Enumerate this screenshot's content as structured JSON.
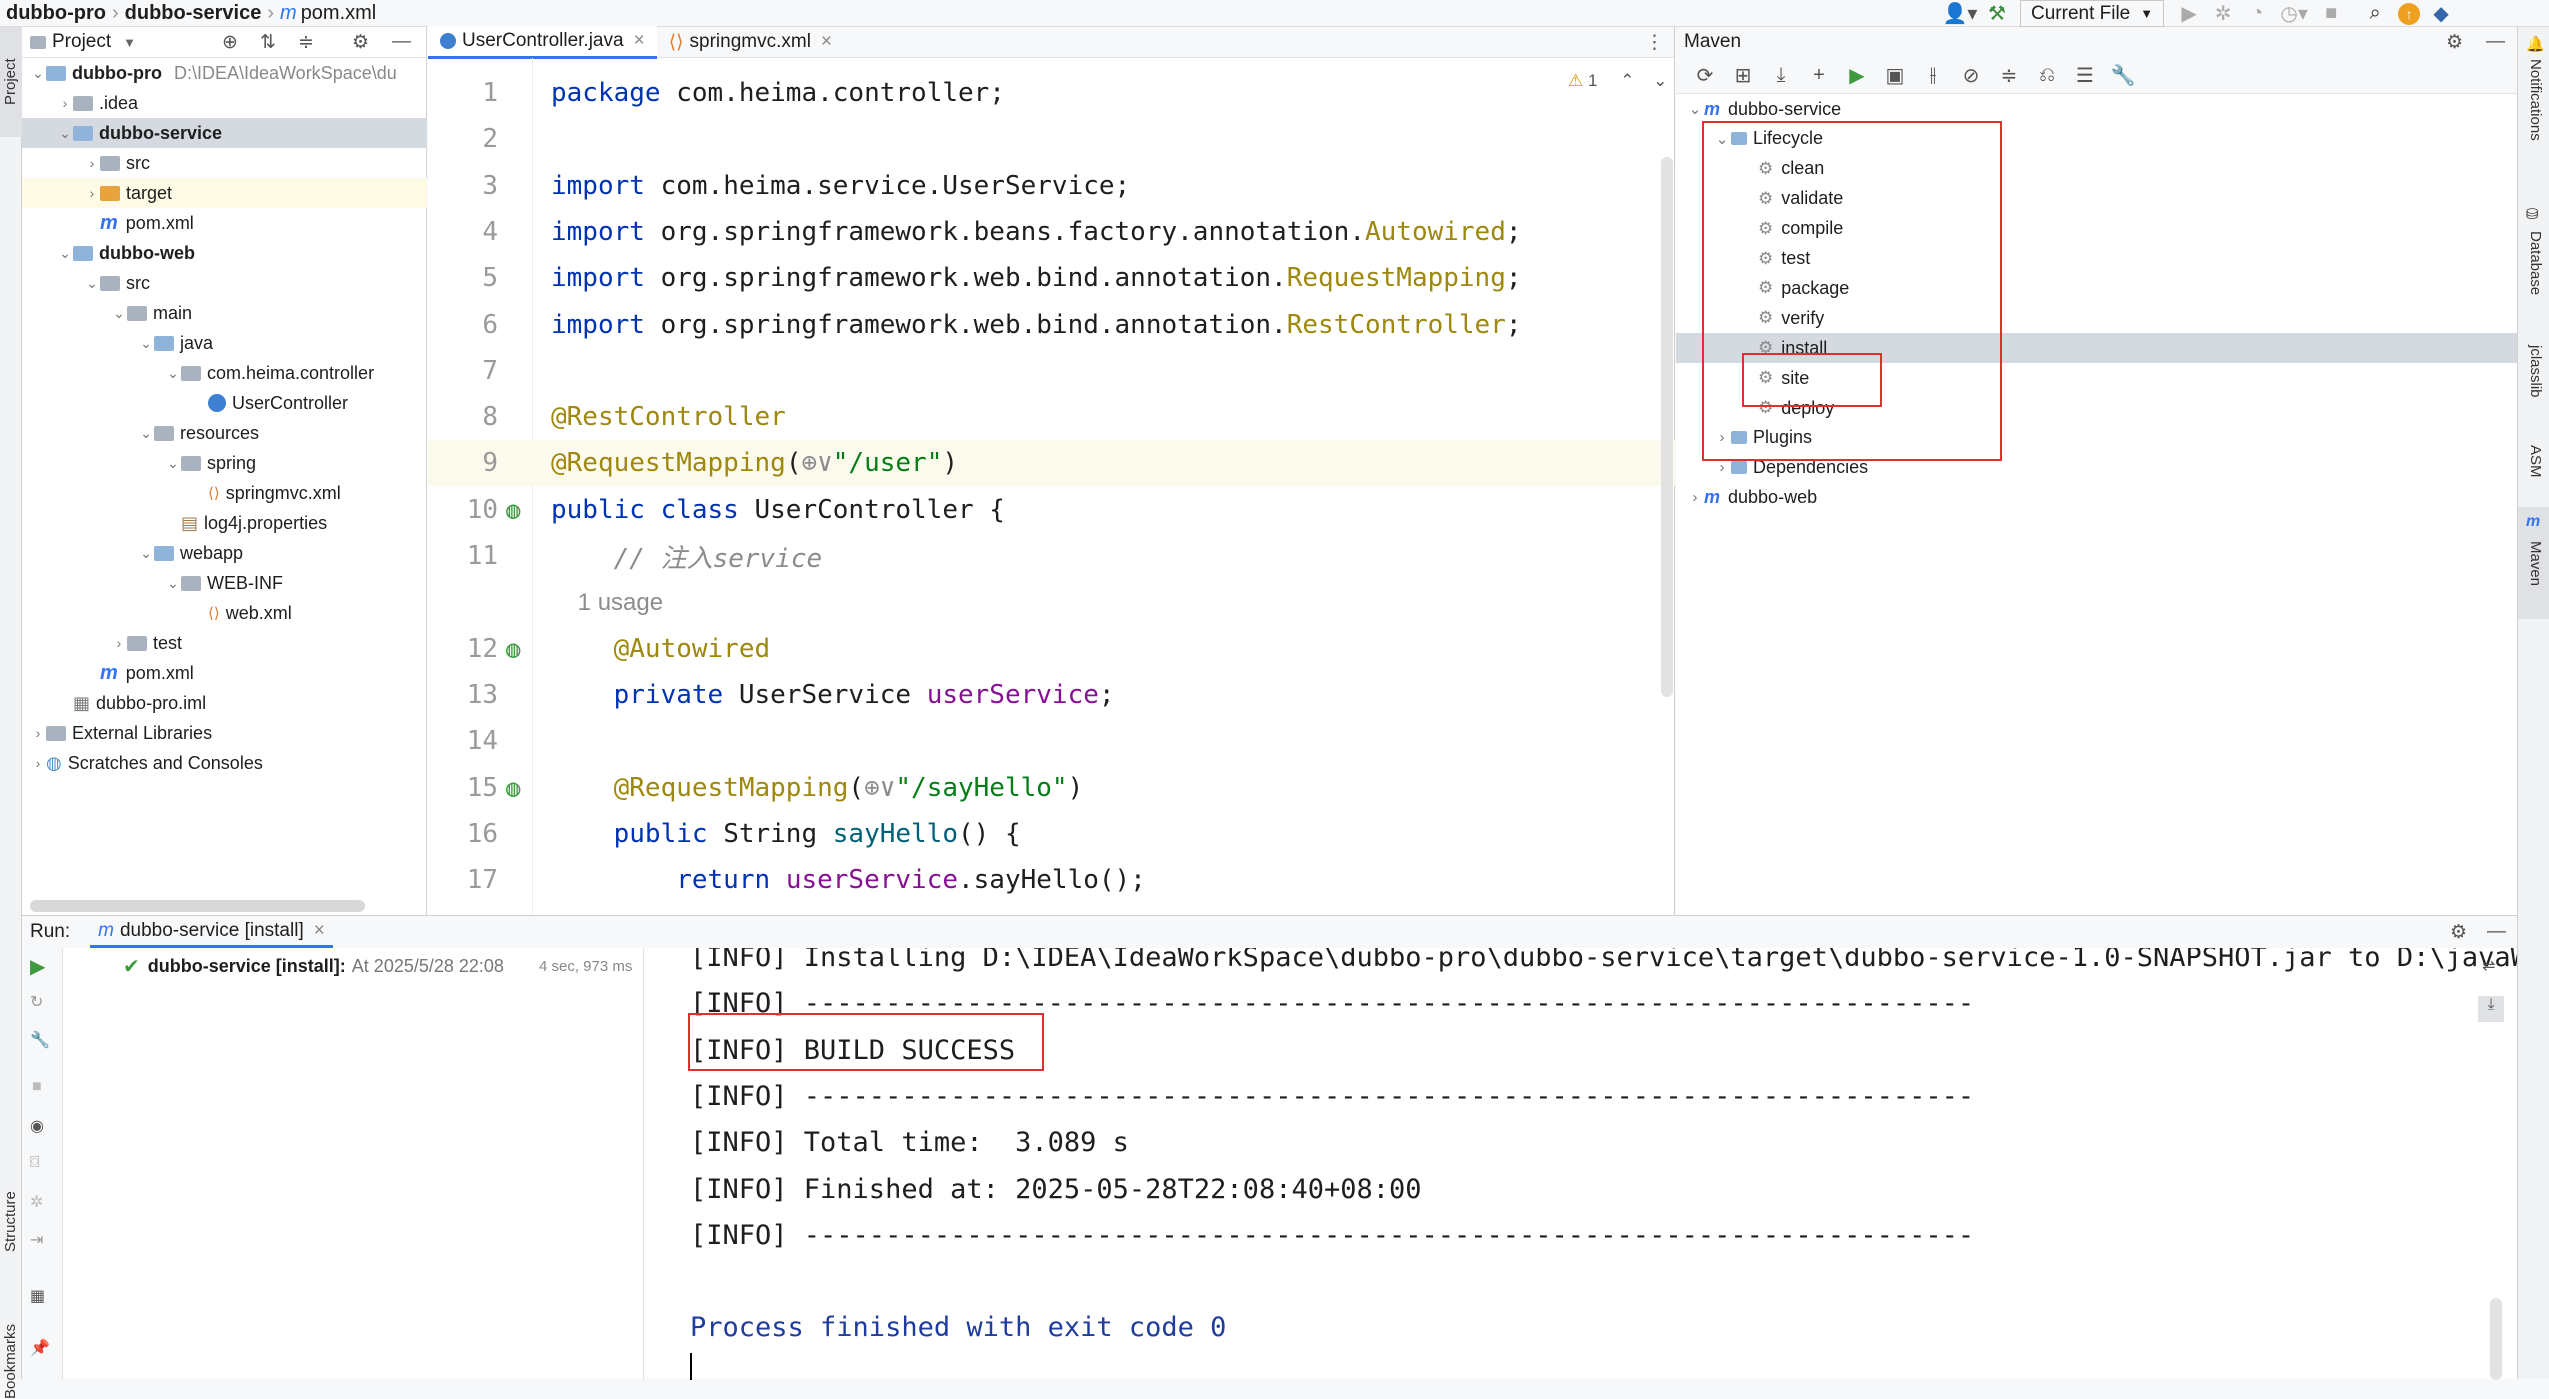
{
  "topbar": {
    "crumbs": [
      "dubbo-pro",
      "dubbo-service",
      "pom.xml"
    ],
    "run_config": "Current File"
  },
  "leftstrip": {
    "project": "Project",
    "structure": "Structure",
    "bookmarks": "Bookmarks"
  },
  "project": {
    "title": "Project",
    "tree": [
      {
        "label": "dubbo-pro",
        "bold": true,
        "path": "D:\\IDEA\\IdeaWorkSpace\\du",
        "indent": 0,
        "arrow": "v",
        "icon": "module"
      },
      {
        "label": ".idea",
        "indent": 1,
        "arrow": ">",
        "icon": "folder"
      },
      {
        "label": "dubbo-service",
        "bold": true,
        "indent": 1,
        "arrow": "v",
        "icon": "module",
        "selected": true
      },
      {
        "label": "src",
        "indent": 2,
        "arrow": ">",
        "icon": "folder"
      },
      {
        "label": "target",
        "indent": 2,
        "arrow": ">",
        "icon": "folder-orange",
        "highlight": true
      },
      {
        "label": "pom.xml",
        "indent": 2,
        "arrow": "",
        "icon": "maven"
      },
      {
        "label": "dubbo-web",
        "bold": true,
        "indent": 1,
        "arrow": "v",
        "icon": "module"
      },
      {
        "label": "src",
        "indent": 2,
        "arrow": "v",
        "icon": "folder"
      },
      {
        "label": "main",
        "indent": 3,
        "arrow": "v",
        "icon": "folder"
      },
      {
        "label": "java",
        "indent": 4,
        "arrow": "v",
        "icon": "folder-blue"
      },
      {
        "label": "com.heima.controller",
        "indent": 5,
        "arrow": "v",
        "icon": "package"
      },
      {
        "label": "UserController",
        "indent": 6,
        "arrow": "",
        "icon": "class"
      },
      {
        "label": "resources",
        "indent": 4,
        "arrow": "v",
        "icon": "folder"
      },
      {
        "label": "spring",
        "indent": 5,
        "arrow": "v",
        "icon": "folder"
      },
      {
        "label": "springmvc.xml",
        "indent": 6,
        "arrow": "",
        "icon": "xml"
      },
      {
        "label": "log4j.properties",
        "indent": 5,
        "arrow": "",
        "icon": "props"
      },
      {
        "label": "webapp",
        "indent": 4,
        "arrow": "v",
        "icon": "folder-blue"
      },
      {
        "label": "WEB-INF",
        "indent": 5,
        "arrow": "v",
        "icon": "folder"
      },
      {
        "label": "web.xml",
        "indent": 6,
        "arrow": "",
        "icon": "xml"
      },
      {
        "label": "test",
        "indent": 3,
        "arrow": ">",
        "icon": "folder"
      },
      {
        "label": "pom.xml",
        "indent": 2,
        "arrow": "",
        "icon": "maven"
      },
      {
        "label": "dubbo-pro.iml",
        "indent": 1,
        "arrow": "",
        "icon": "iml"
      },
      {
        "label": "External Libraries",
        "indent": 0,
        "arrow": ">",
        "icon": "libs"
      },
      {
        "label": "Scratches and Consoles",
        "indent": 0,
        "arrow": ">",
        "icon": "scratch"
      }
    ]
  },
  "editor": {
    "tabs": [
      {
        "label": "UserController.java",
        "active": true
      },
      {
        "label": "springmvc.xml",
        "active": false
      }
    ],
    "warning_count": "1",
    "lines": [
      {
        "n": "1",
        "tokens": [
          [
            "kw",
            "package "
          ],
          [
            "",
            "com.heima.controller;"
          ]
        ]
      },
      {
        "n": "2",
        "tokens": []
      },
      {
        "n": "3",
        "tokens": [
          [
            "kw",
            "import "
          ],
          [
            "",
            "com.heima.service.UserService;"
          ]
        ]
      },
      {
        "n": "4",
        "tokens": [
          [
            "kw",
            "import "
          ],
          [
            "",
            "org.springframework.beans.factory.annotation."
          ],
          [
            "ann",
            "Autowired"
          ],
          [
            "",
            ";"
          ]
        ]
      },
      {
        "n": "5",
        "tokens": [
          [
            "kw",
            "import "
          ],
          [
            "",
            "org.springframework.web.bind.annotation."
          ],
          [
            "ann",
            "RequestMapping"
          ],
          [
            "",
            ";"
          ]
        ]
      },
      {
        "n": "6",
        "tokens": [
          [
            "kw",
            "import "
          ],
          [
            "",
            "org.springframework.web.bind.annotation."
          ],
          [
            "ann",
            "RestController"
          ],
          [
            "",
            ";"
          ]
        ]
      },
      {
        "n": "7",
        "tokens": []
      },
      {
        "n": "8",
        "tokens": [
          [
            "ann",
            "@RestController"
          ]
        ]
      },
      {
        "n": "9",
        "tokens": [
          [
            "ann",
            "@RequestMapping"
          ],
          [
            "",
            "("
          ],
          [
            "cmt",
            "⊕∨"
          ],
          [
            "str",
            "\"/user\""
          ],
          [
            "",
            ")"
          ]
        ],
        "current": true
      },
      {
        "n": "10",
        "tokens": [
          [
            "kw",
            "public class "
          ],
          [
            "",
            "UserController {"
          ]
        ]
      },
      {
        "n": "11",
        "tokens": [
          [
            "cmt",
            "    // 注入service"
          ]
        ]
      },
      {
        "n": "",
        "tokens": [
          [
            "hint",
            "    1 usage"
          ]
        ]
      },
      {
        "n": "12",
        "tokens": [
          [
            "ann",
            "    @Autowired"
          ]
        ]
      },
      {
        "n": "13",
        "tokens": [
          [
            "kw",
            "    private "
          ],
          [
            "",
            "UserService "
          ],
          [
            "fld",
            "userService"
          ],
          [
            "",
            ";"
          ]
        ]
      },
      {
        "n": "14",
        "tokens": []
      },
      {
        "n": "15",
        "tokens": [
          [
            "ann",
            "    @RequestMapping"
          ],
          [
            "",
            "("
          ],
          [
            "cmt",
            "⊕∨"
          ],
          [
            "str",
            "\"/sayHello\""
          ],
          [
            "",
            ")"
          ]
        ]
      },
      {
        "n": "16",
        "tokens": [
          [
            "kw",
            "    public "
          ],
          [
            "",
            "String "
          ],
          [
            "mth",
            "sayHello"
          ],
          [
            "",
            "() {"
          ]
        ]
      },
      {
        "n": "17",
        "tokens": [
          [
            "kw",
            "        return "
          ],
          [
            "fld",
            "userService"
          ],
          [
            "",
            ".sayHello();"
          ]
        ]
      }
    ]
  },
  "maven": {
    "title": "Maven",
    "tree": [
      {
        "label": "dubbo-service",
        "indent": 0,
        "arrow": "v",
        "icon": "mvn"
      },
      {
        "label": "Lifecycle",
        "indent": 1,
        "arrow": "v",
        "icon": "folder"
      },
      {
        "label": "clean",
        "indent": 2,
        "icon": "gear"
      },
      {
        "label": "validate",
        "indent": 2,
        "icon": "gear"
      },
      {
        "label": "compile",
        "indent": 2,
        "icon": "gear"
      },
      {
        "label": "test",
        "indent": 2,
        "icon": "gear"
      },
      {
        "label": "package",
        "indent": 2,
        "icon": "gear"
      },
      {
        "label": "verify",
        "indent": 2,
        "icon": "gear"
      },
      {
        "label": "install",
        "indent": 2,
        "icon": "gear",
        "selected": true
      },
      {
        "label": "site",
        "indent": 2,
        "icon": "gear"
      },
      {
        "label": "deploy",
        "indent": 2,
        "icon": "gear"
      },
      {
        "label": "Plugins",
        "indent": 1,
        "arrow": ">",
        "icon": "folder"
      },
      {
        "label": "Dependencies",
        "indent": 1,
        "arrow": ">",
        "icon": "folder"
      },
      {
        "label": "dubbo-web",
        "indent": 0,
        "arrow": ">",
        "icon": "mvn"
      }
    ]
  },
  "rightstrip": {
    "notifications": "Notifications",
    "database": "Database",
    "jclasslib": "jclasslib",
    "asm": "ASM",
    "maven": "Maven"
  },
  "run": {
    "label": "Run:",
    "tab": "dubbo-service [install]",
    "item_name": "dubbo-service [install]:",
    "item_time": "At 2025/5/28 22:08",
    "item_duration": "4 sec, 973 ms",
    "console": [
      "[INFO] Installing D:\\IDEA\\IdeaWorkSpace\\dubbo-pro\\dubbo-service\\target\\dubbo-service-1.0-SNAPSHOT.jar to D:\\javaW",
      "[INFO] ------------------------------------------------------------------------",
      "[INFO] BUILD SUCCESS",
      "[INFO] ------------------------------------------------------------------------",
      "[INFO] Total time:  3.089 s",
      "[INFO] Finished at: 2025-05-28T22:08:40+08:00",
      "[INFO] ------------------------------------------------------------------------",
      "",
      "Process finished with exit code 0"
    ]
  }
}
